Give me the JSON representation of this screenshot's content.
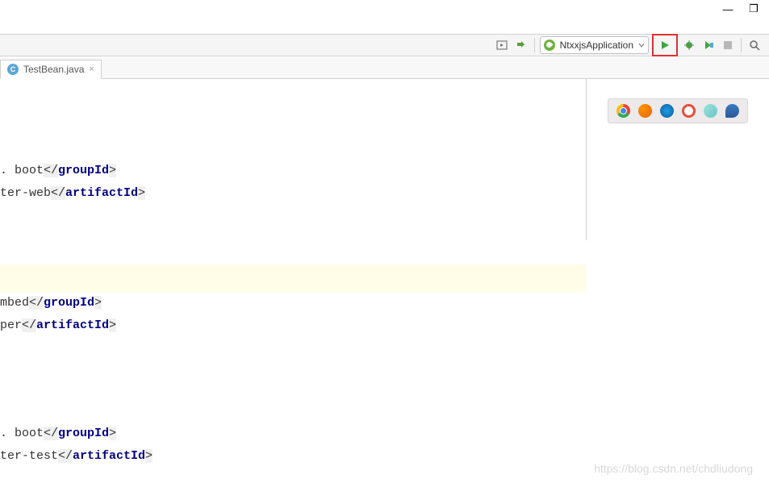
{
  "window": {
    "minimize": "—",
    "restore": "❐"
  },
  "toolbar": {
    "run_config_label": "NtxxjsApplication"
  },
  "tabs": [
    {
      "label": "TestBean.java",
      "icon": "C"
    }
  ],
  "editor": {
    "lines": [
      {
        "prefix": ". boot",
        "tag": "groupId"
      },
      {
        "prefix": "ter-web",
        "tag": "artifactId"
      },
      {
        "prefix": "mbed",
        "tag": "groupId"
      },
      {
        "prefix": "per",
        "tag": "artifactId"
      },
      {
        "prefix": ". boot",
        "tag": "groupId"
      },
      {
        "prefix": "ter-test",
        "tag": "artifactId"
      }
    ]
  },
  "browsers": {
    "chrome": "#f4c042",
    "firefox": "#e66000",
    "safari": "#1c9dea",
    "opera": "#e74c3c",
    "yandex": "#64c8c8",
    "edge": "#2c5898"
  },
  "watermark": "https://blog.csdn.net/chdliudong"
}
